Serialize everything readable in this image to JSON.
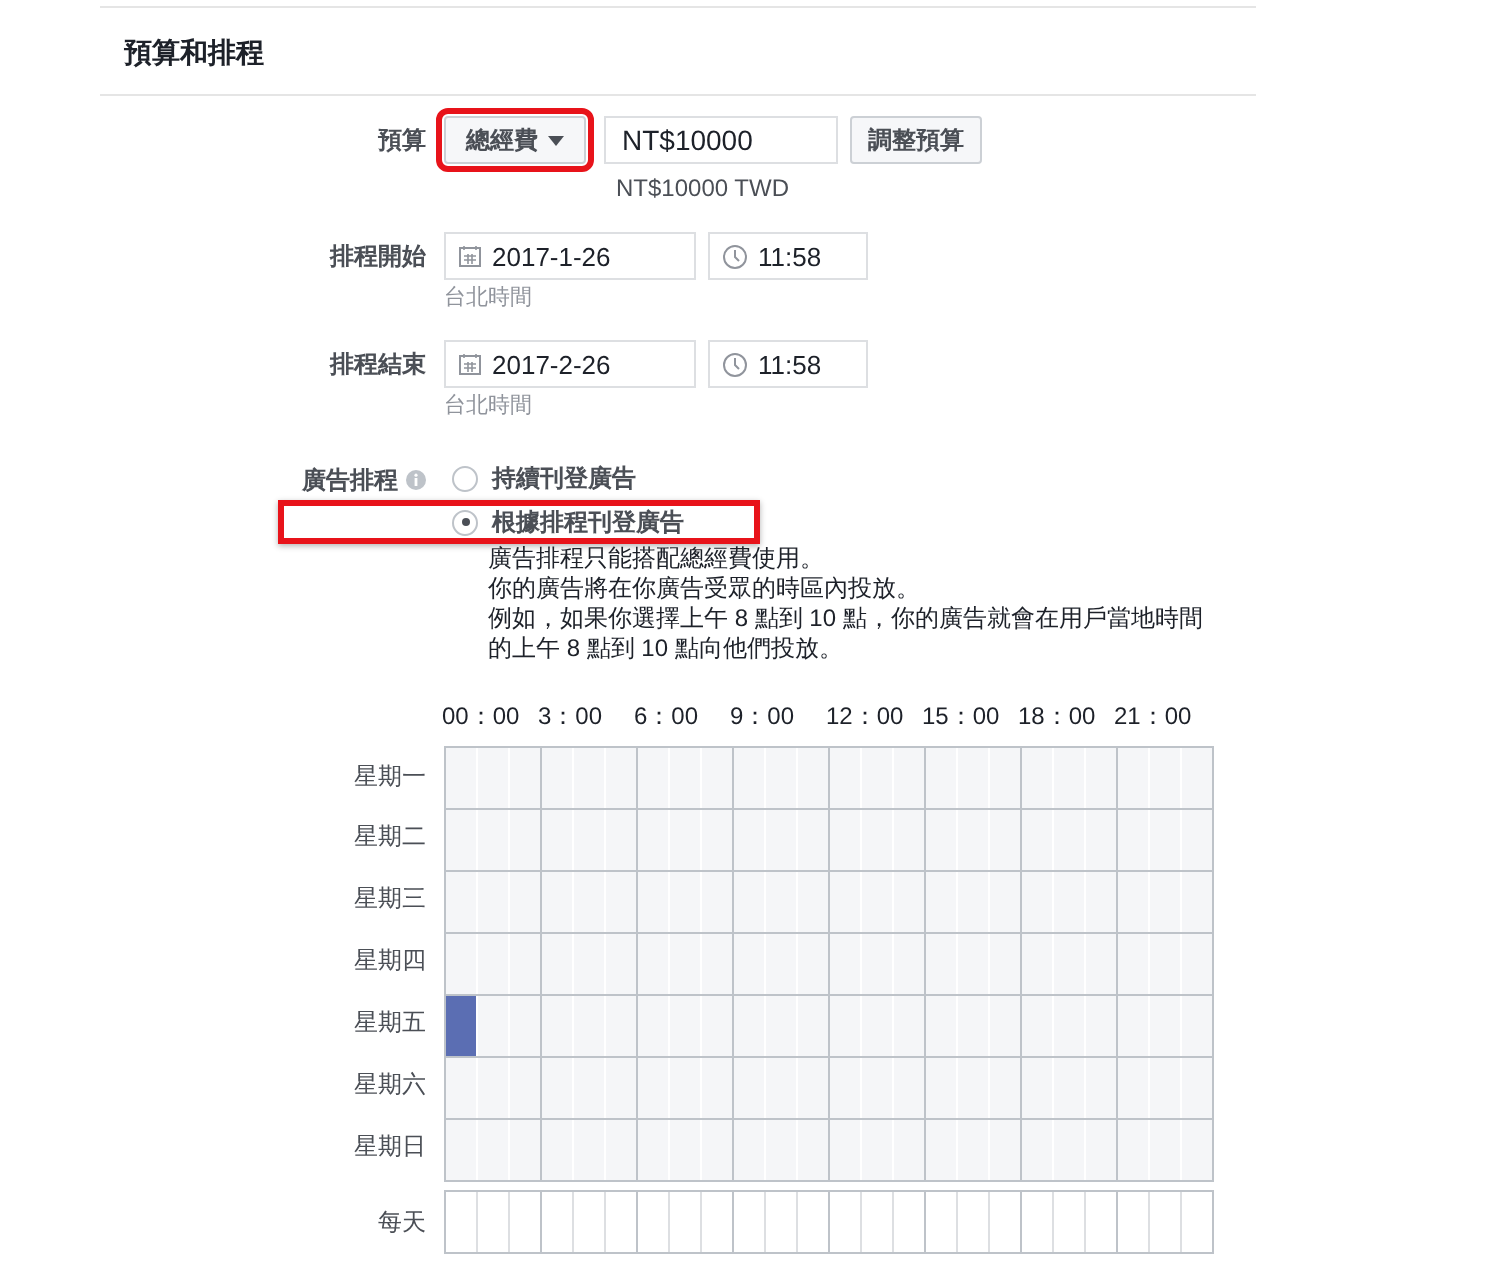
{
  "section_title": "預算和排程",
  "budget": {
    "label": "預算",
    "type_dropdown": {
      "value": "總經費",
      "highlighted": true
    },
    "amount": "NT$10000",
    "adjust_button": "調整預算",
    "hint": "NT$10000 TWD"
  },
  "schedule_start": {
    "label": "排程開始",
    "date": "2017-1-26",
    "time": "11:58",
    "timezone": "台北時間"
  },
  "schedule_end": {
    "label": "排程結束",
    "date": "2017-2-26",
    "time": "11:58",
    "timezone": "台北時間"
  },
  "ad_scheduling": {
    "label": "廣告排程",
    "options": [
      {
        "label": "持續刊登廣告",
        "selected": false,
        "highlighted": false
      },
      {
        "label": "根據排程刊登廣告",
        "selected": true,
        "highlighted": true
      }
    ],
    "description": [
      "廣告排程只能搭配總經費使用。",
      "你的廣告將在你廣告受眾的時區內投放。",
      "例如，如果你選擇上午 8 點到 10 點，你的廣告就會在用戶當地時間的上午 8 點到 10 點向他們投放。"
    ]
  },
  "hour_labels": [
    "00：00",
    "3：00",
    "6：00",
    "9：00",
    "12：00",
    "15：00",
    "18：00",
    "21：00"
  ],
  "days": [
    {
      "label": "星期一",
      "slots": [
        false,
        false,
        false,
        false,
        false,
        false,
        false,
        false,
        false,
        false,
        false,
        false,
        false,
        false,
        false,
        false,
        false,
        false,
        false,
        false,
        false,
        false,
        false,
        false
      ]
    },
    {
      "label": "星期二",
      "slots": [
        false,
        false,
        false,
        false,
        false,
        false,
        false,
        false,
        false,
        false,
        false,
        false,
        false,
        false,
        false,
        false,
        false,
        false,
        false,
        false,
        false,
        false,
        false,
        false
      ]
    },
    {
      "label": "星期三",
      "slots": [
        false,
        false,
        false,
        false,
        false,
        false,
        false,
        false,
        false,
        false,
        false,
        false,
        false,
        false,
        false,
        false,
        false,
        false,
        false,
        false,
        false,
        false,
        false,
        false
      ]
    },
    {
      "label": "星期四",
      "slots": [
        false,
        false,
        false,
        false,
        false,
        false,
        false,
        false,
        false,
        false,
        false,
        false,
        false,
        false,
        false,
        false,
        false,
        false,
        false,
        false,
        false,
        false,
        false,
        false
      ]
    },
    {
      "label": "星期五",
      "slots": [
        true,
        false,
        false,
        false,
        false,
        false,
        false,
        false,
        false,
        false,
        false,
        false,
        false,
        false,
        false,
        false,
        false,
        false,
        false,
        false,
        false,
        false,
        false,
        false
      ]
    },
    {
      "label": "星期六",
      "slots": [
        false,
        false,
        false,
        false,
        false,
        false,
        false,
        false,
        false,
        false,
        false,
        false,
        false,
        false,
        false,
        false,
        false,
        false,
        false,
        false,
        false,
        false,
        false,
        false
      ]
    },
    {
      "label": "星期日",
      "slots": [
        false,
        false,
        false,
        false,
        false,
        false,
        false,
        false,
        false,
        false,
        false,
        false,
        false,
        false,
        false,
        false,
        false,
        false,
        false,
        false,
        false,
        false,
        false,
        false
      ]
    }
  ],
  "every_day": {
    "label": "每天",
    "slots": [
      false,
      false,
      false,
      false,
      false,
      false,
      false,
      false,
      false,
      false,
      false,
      false,
      false,
      false,
      false,
      false,
      false,
      false,
      false,
      false,
      false,
      false,
      false,
      false
    ]
  }
}
